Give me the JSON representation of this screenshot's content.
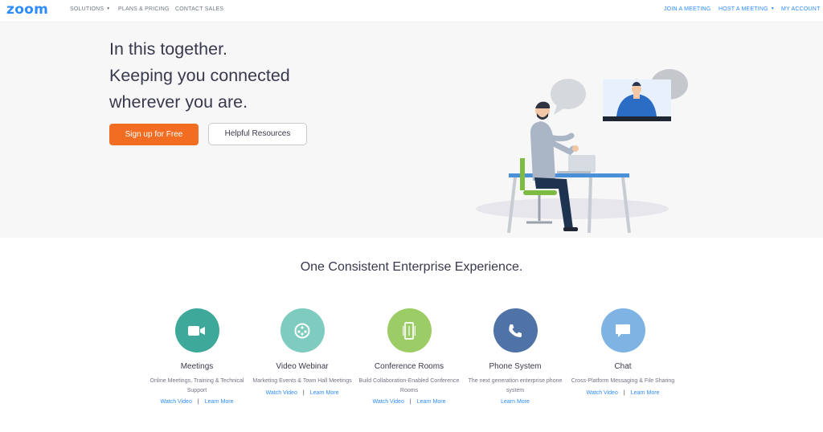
{
  "brand": {
    "logo_text": "zoom",
    "accent": "#2d8cff",
    "cta_color": "#f26d21"
  },
  "nav": {
    "left": [
      {
        "label": "SOLUTIONS",
        "has_caret": true
      },
      {
        "label": "PLANS & PRICING",
        "has_caret": false
      },
      {
        "label": "CONTACT SALES",
        "has_caret": false
      }
    ],
    "right": [
      {
        "label": "JOIN A MEETING",
        "has_caret": false
      },
      {
        "label": "HOST A MEETING",
        "has_caret": true
      },
      {
        "label": "MY ACCOUNT",
        "has_caret": false
      }
    ]
  },
  "hero": {
    "headline_lines": [
      "In this together.",
      "Keeping you connected",
      "wherever you are."
    ],
    "primary_button": "Sign up for Free",
    "secondary_button": "Helpful Resources",
    "illustration": "person-on-video-call-illustration"
  },
  "section": {
    "title": "One Consistent Enterprise Experience.",
    "features": [
      {
        "name": "Meetings",
        "icon": "video-camera-icon",
        "color": "#3ea99a",
        "desc": "Online Meetings, Training & Technical Support",
        "links": [
          "Watch Video",
          "Learn More"
        ]
      },
      {
        "name": "Video Webinar",
        "icon": "webinar-icon",
        "color": "#7ecbc0",
        "desc": "Marketing Events & Town Hall Meetings",
        "links": [
          "Watch Video",
          "Learn More"
        ]
      },
      {
        "name": "Conference Rooms",
        "icon": "conference-room-icon",
        "color": "#9ccc65",
        "desc": "Build Collaboration-Enabled Conference Rooms",
        "links": [
          "Watch Video",
          "Learn More"
        ]
      },
      {
        "name": "Phone System",
        "icon": "phone-icon",
        "color": "#4f73a6",
        "desc": "The next generation enterprise phone system",
        "links": [
          "Learn More"
        ]
      },
      {
        "name": "Chat",
        "icon": "chat-icon",
        "color": "#7fb3e3",
        "desc": "Cross-Platform Messaging & File Sharing",
        "links": [
          "Watch Video",
          "Learn More"
        ]
      }
    ]
  }
}
